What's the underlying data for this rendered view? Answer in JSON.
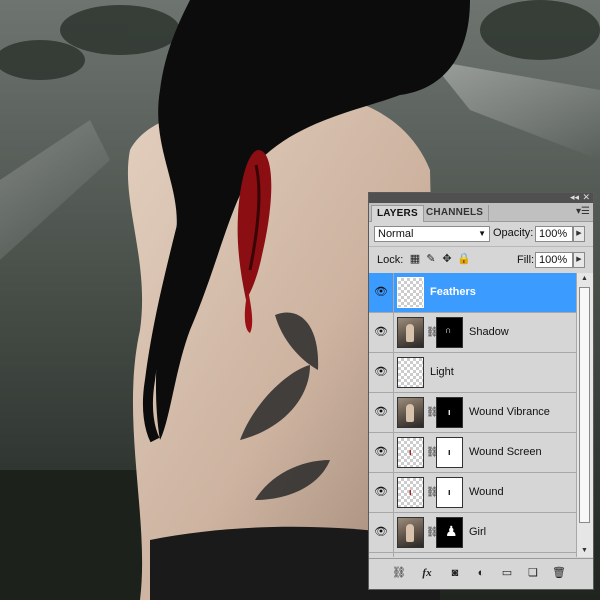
{
  "tabs": [
    "LAYERS",
    "CHANNELS"
  ],
  "blend_mode": "Normal",
  "opacity_label": "Opacity:",
  "opacity_value": "100%",
  "lock_label": "Lock:",
  "fill_label": "Fill:",
  "fill_value": "100%",
  "layers": [
    {
      "name": "Feathers",
      "selected": true
    },
    {
      "name": "Shadow",
      "selected": false
    },
    {
      "name": "Light",
      "selected": false
    },
    {
      "name": "Wound Vibrance",
      "selected": false
    },
    {
      "name": "Wound Screen",
      "selected": false
    },
    {
      "name": "Wound",
      "selected": false
    },
    {
      "name": "Girl",
      "selected": false
    }
  ],
  "icons": {
    "eye": "eye-icon",
    "link": "link-icon",
    "fx": "fx-icon",
    "mask": "add-mask-icon",
    "adjustment": "adjustment-layer-icon",
    "group": "new-group-icon",
    "new_layer": "new-layer-icon",
    "trash": "trash-icon"
  },
  "colors": {
    "selection": "#3c9bff",
    "panel_bg": "#d6d6d6",
    "wound_red": "#8b0e12"
  }
}
